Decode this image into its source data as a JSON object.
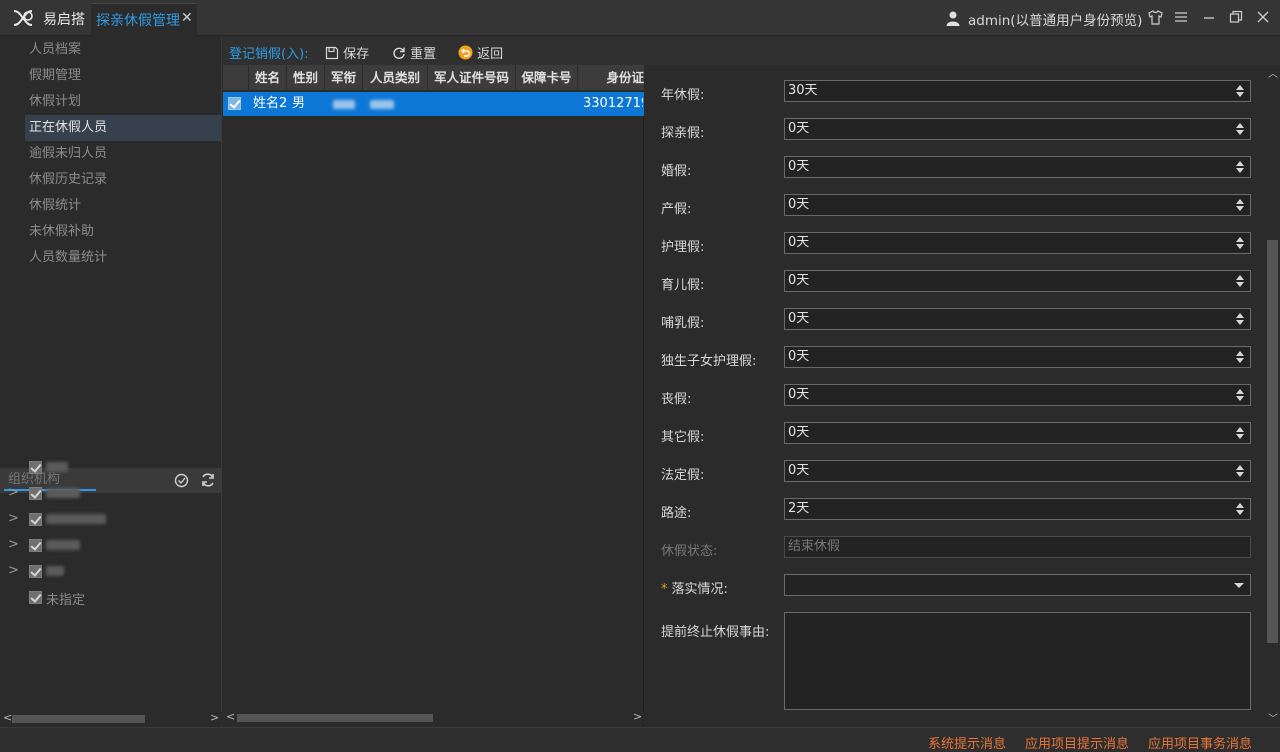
{
  "app": {
    "name": "易启搭",
    "tab_label": "探亲休假管理",
    "tab_close": "✕"
  },
  "user": {
    "text": "admin(以普通用户身份预览)"
  },
  "sidebar": {
    "items": [
      {
        "label": "人员档案"
      },
      {
        "label": "假期管理"
      },
      {
        "label": "休假计划"
      },
      {
        "label": "正在休假人员",
        "active": true
      },
      {
        "label": "逾假未归人员"
      },
      {
        "label": "休假历史记录"
      },
      {
        "label": "休假统计"
      },
      {
        "label": "未休假补助"
      },
      {
        "label": "人员数量统计"
      }
    ],
    "org_placeholder": "组织机构",
    "tree": [
      {
        "label": "",
        "blurred": true
      },
      {
        "label": "",
        "blurred": true
      },
      {
        "label": "",
        "blurred": true
      },
      {
        "label": "",
        "blurred": true
      },
      {
        "label": "",
        "blurred": true
      },
      {
        "label": "未指定"
      }
    ]
  },
  "toolbar": {
    "title": "登记销假(入):",
    "save": "保存",
    "reset": "重置",
    "back": "返回"
  },
  "grid": {
    "columns": [
      "姓名",
      "性别",
      "军衔",
      "人员类别",
      "军人证件号码",
      "保障卡号",
      "身份证"
    ],
    "rows": [
      {
        "name": "姓名2",
        "gender": "男",
        "id_card": "330127199"
      }
    ]
  },
  "form": {
    "fields": [
      {
        "label": "年休假:",
        "value": "30天"
      },
      {
        "label": "探亲假:",
        "value": "0天"
      },
      {
        "label": "婚假:",
        "value": "0天"
      },
      {
        "label": "产假:",
        "value": "0天"
      },
      {
        "label": "护理假:",
        "value": "0天"
      },
      {
        "label": "育儿假:",
        "value": "0天"
      },
      {
        "label": "哺乳假:",
        "value": "0天"
      },
      {
        "label": "独生子女护理假:",
        "value": "0天"
      },
      {
        "label": "丧假:",
        "value": "0天"
      },
      {
        "label": "其它假:",
        "value": "0天"
      },
      {
        "label": "法定假:",
        "value": "0天"
      },
      {
        "label": "路途:",
        "value": "2天"
      }
    ],
    "status_label": "休假状态:",
    "status_value": "结束休假",
    "required_mark": "*",
    "implementation_label": "落实情况:",
    "implementation_value": "",
    "reason_label": "提前终止休假事由:"
  },
  "status_bar": {
    "messages": [
      "系统提示消息",
      "应用项目提示消息",
      "应用项目事务消息"
    ]
  }
}
